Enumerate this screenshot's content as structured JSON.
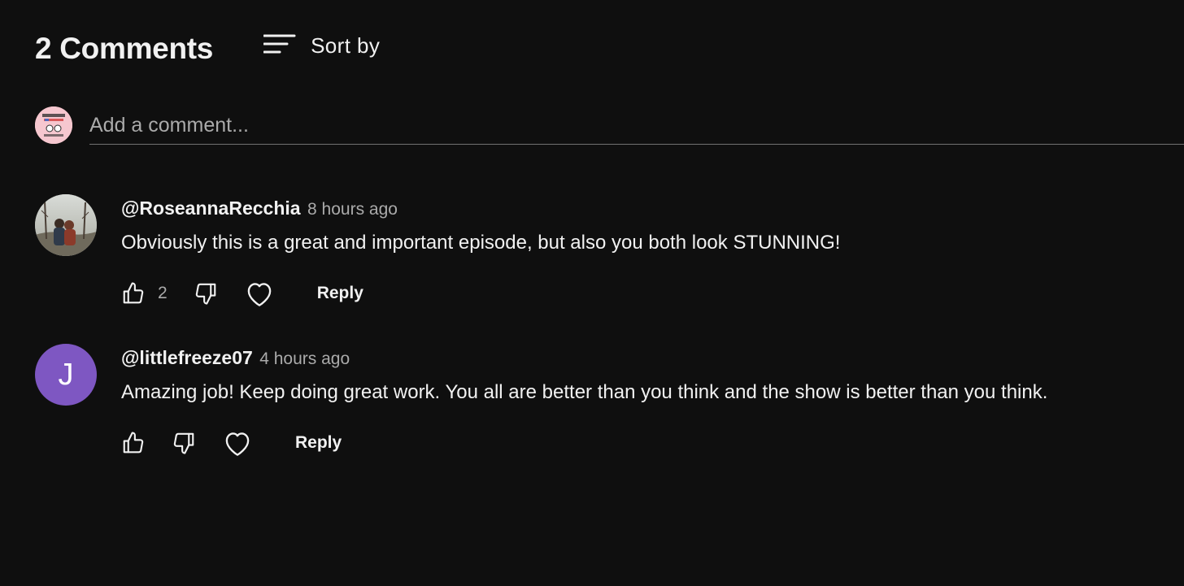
{
  "header": {
    "title": "2 Comments",
    "sort_label": "Sort by"
  },
  "add_comment": {
    "placeholder": "Add a comment..."
  },
  "comments": [
    {
      "author": "@RoseannaRecchia",
      "time": "8 hours ago",
      "text": "Obviously this is a great and important episode, but also you both look STUNNING!",
      "like_count": "2",
      "reply_label": "Reply"
    },
    {
      "author": "@littlefreeze07",
      "avatar_letter": "J",
      "time": "4 hours ago",
      "text": "Amazing job! Keep doing great work. You all are better than you think and the show is better than you think.",
      "reply_label": "Reply"
    }
  ],
  "colors": {
    "background": "#0f0f0f",
    "text_primary": "#f1f1f1",
    "text_secondary": "#aaaaaa",
    "divider": "#717171",
    "avatar_purple": "#7e57c2",
    "self_avatar_pink": "#f6c7cf"
  },
  "icons": {
    "sort": "sort-lines-icon",
    "like": "thumbs-up-icon",
    "dislike": "thumbs-down-icon",
    "heart": "heart-icon"
  }
}
